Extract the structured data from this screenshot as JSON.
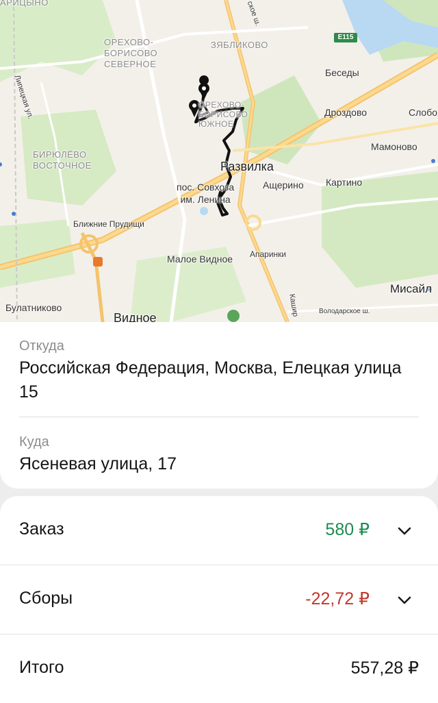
{
  "map": {
    "labels": {
      "caricyno": "АРИЦЫНО",
      "orekhovo_north": "ОРЕХОВО-\nБОРИСОВО\nСЕВЕРНОЕ",
      "zyablikovo": "ЗЯБЛИКОВО",
      "orekhovo_south": "ОРЕХОВО-\nБОРИСОВО\nЮЖНОЕ",
      "biryulyovo": "БИРЮЛЁВО\nВОСТОЧНОЕ",
      "lipetskaya": "Липецкая ул.",
      "kashirskoe_top": "ское ш.",
      "e115": "E115",
      "besedy": "Беседы",
      "drozdovo": "Дроздово",
      "slobo": "Слобо",
      "mamonovo": "Мамоново",
      "razvilka": "Развилка",
      "ashcherino": "Ащерино",
      "kartino": "Картино",
      "sovkhoz": "пос. Совхоза\nим. Ленина",
      "blizhnie": "Ближние Прудищи",
      "maloe": "Малое Видное",
      "aparinki": "Апаринки",
      "misay": "Мисайл",
      "kashir_bottom": "Кашир",
      "volodarskoe": "Володарское ш.",
      "bulatnikovo": "Булатниково",
      "vidnoe": "Видное"
    }
  },
  "address": {
    "from_label": "Откуда",
    "from_value": "Российская Федерация, Москва, Елецкая улица 15",
    "to_label": "Куда",
    "to_value": "Ясеневая улица, 17"
  },
  "price": {
    "order_label": "Заказ",
    "order_amount": "580 ₽",
    "fees_label": "Сборы",
    "fees_amount": "-22,72 ₽",
    "total_label": "Итого",
    "total_amount": "557,28 ₽"
  },
  "colors": {
    "positive": "#1e8a52",
    "negative": "#c0392b"
  }
}
